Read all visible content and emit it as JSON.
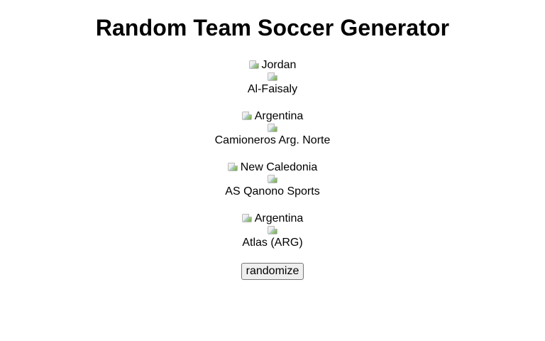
{
  "title": "Random Team Soccer Generator",
  "teams": [
    {
      "country": "Jordan",
      "club": "Al-Faisaly",
      "flag_icon": "flag-icon",
      "crest_icon": "crest-icon"
    },
    {
      "country": "Argentina",
      "club": "Camioneros Arg. Norte",
      "flag_icon": "flag-icon",
      "crest_icon": "crest-icon"
    },
    {
      "country": "New Caledonia",
      "club": "AS Qanono Sports",
      "flag_icon": "flag-icon",
      "crest_icon": "crest-icon"
    },
    {
      "country": "Argentina",
      "club": "Atlas (ARG)",
      "flag_icon": "flag-icon",
      "crest_icon": "crest-icon"
    }
  ],
  "randomize_label": "randomize"
}
